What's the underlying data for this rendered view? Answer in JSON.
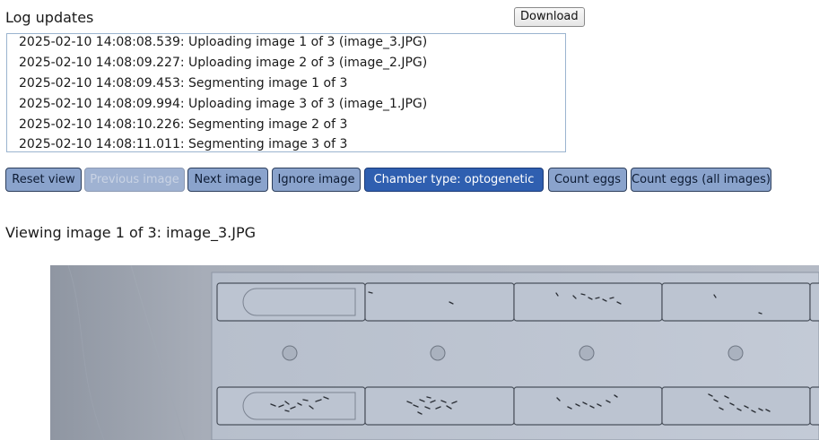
{
  "log": {
    "title": "Log updates",
    "download_label": "Download",
    "entries": [
      "2025-02-10 14:08:08.539: Uploading image 1 of 3 (image_3.JPG)",
      "2025-02-10 14:08:09.227: Uploading image 2 of 3 (image_2.JPG)",
      "2025-02-10 14:08:09.453: Segmenting image 1 of 3",
      "2025-02-10 14:08:09.994: Uploading image 3 of 3 (image_1.JPG)",
      "2025-02-10 14:08:10.226: Segmenting image 2 of 3",
      "2025-02-10 14:08:11.011: Segmenting image 3 of 3"
    ]
  },
  "toolbar": {
    "reset_view": "Reset view",
    "previous_image": "Previous image",
    "next_image": "Next image",
    "ignore_image": "Ignore image",
    "chamber_type": "Chamber type: optogenetic",
    "count_eggs": "Count eggs",
    "count_eggs_all": "Count eggs (all images)"
  },
  "viewer": {
    "status": "Viewing image 1 of 3: image_3.JPG"
  },
  "colors": {
    "button_bg": "#8aa3cc",
    "button_active_bg": "#2f5fb0",
    "log_border": "#9bb4cf"
  }
}
